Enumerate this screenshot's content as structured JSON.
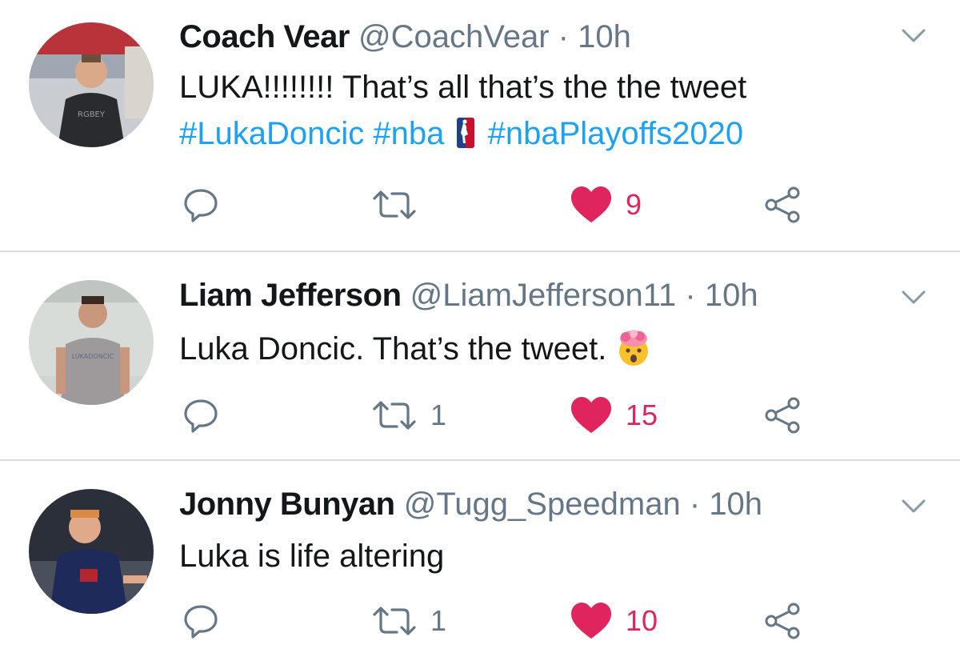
{
  "tweets": [
    {
      "name": "Coach Vear",
      "handle": "@CoachVear",
      "separator": "·",
      "time": "10h",
      "text": "LUKA!!!!!!!! That’s all that’s the the tweet",
      "hashtags": [
        "#LukaDoncic",
        "#nba",
        "#nbaPlayoffs2020"
      ],
      "retweets": "",
      "likes": "9"
    },
    {
      "name": "Liam Jefferson",
      "handle": "@LiamJefferson11",
      "separator": "·",
      "time": "10h",
      "text": "Luka Doncic. That’s the tweet.",
      "emoji": "exploding-head",
      "retweets": "1",
      "likes": "15"
    },
    {
      "name": "Jonny Bunyan",
      "handle": "@Tugg_Speedman",
      "separator": "·",
      "time": "10h",
      "text": "Luka is life altering",
      "retweets": "1",
      "likes": "10"
    }
  ],
  "icons": {
    "reply": "reply-icon",
    "retweet": "retweet-icon",
    "like": "heart-icon",
    "share": "share-icon",
    "menu": "chevron-down-icon"
  },
  "colors": {
    "hashtag": "#1da1f2",
    "like": "#e0245e",
    "secondary_text": "#657786",
    "divider": "#d7dde3"
  }
}
